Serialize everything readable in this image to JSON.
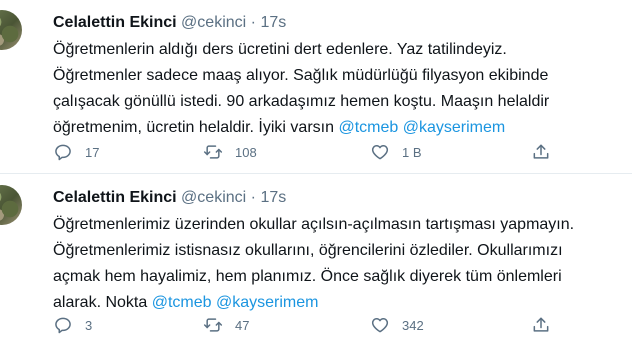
{
  "tweets": [
    {
      "author_name": "Celalettin Ekinci",
      "author_handle": "@cekinci",
      "separator": "·",
      "time": "17s",
      "text_lines": [
        {
          "text": "Öğretmenlerin aldığı ders ücretini dert edenlere. Yaz tatilindeyiz."
        },
        {
          "text": "Öğretmenler sadece maaş alıyor. Sağlık müdürlüğü filyasyon ekibinde"
        },
        {
          "text": "çalışacak gönüllü istedi. 90 arkadaşımız hemen koştu. Maaşın helaldir"
        },
        {
          "text": "öğretmenim, ücretin helaldir. İyiki varsın ",
          "mentions": [
            "@tcmeb",
            "@kayserimem"
          ]
        }
      ],
      "reply_count": "17",
      "retweet_count": "108",
      "like_count": "1 B",
      "share_count": ""
    },
    {
      "author_name": "Celalettin Ekinci",
      "author_handle": "@cekinci",
      "separator": "·",
      "time": "17s",
      "text_lines": [
        {
          "text": "Öğretmenlerimiz üzerinden okullar açılsın-açılmasın tartışması yapmayın."
        },
        {
          "text": "Öğretmenlerimiz istisnasız okullarını, öğrencilerini özlediler. Okullarımızı"
        },
        {
          "text": "açmak hem hayalimiz, hem planımız. Önce sağlık diyerek tüm önlemleri"
        },
        {
          "text": "alarak. Nokta ",
          "mentions": [
            "@tcmeb",
            "@kayserimem"
          ]
        }
      ],
      "reply_count": "3",
      "retweet_count": "47",
      "like_count": "342",
      "share_count": ""
    }
  ],
  "colors": {
    "text": "#0f1419",
    "muted": "#5b7083",
    "mention": "#1b95e0",
    "divider": "#e6ecf0"
  },
  "icons": [
    "reply-icon",
    "retweet-icon",
    "like-icon",
    "share-icon"
  ]
}
